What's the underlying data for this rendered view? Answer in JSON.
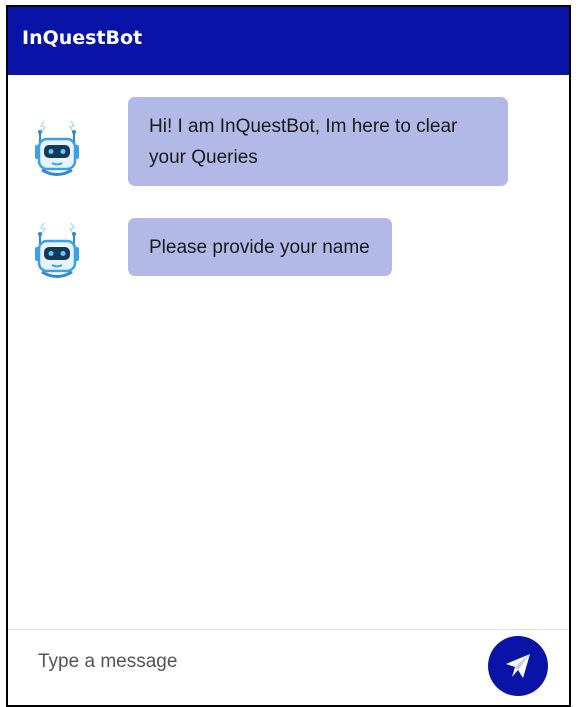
{
  "header": {
    "title": "InQuestBot"
  },
  "messages": [
    {
      "sender": "bot",
      "avatar_icon": "robot-icon",
      "text": "Hi! I am InQuestBot, Im here to clear your Queries"
    },
    {
      "sender": "bot",
      "avatar_icon": "robot-icon",
      "text": "Please provide your name"
    }
  ],
  "composer": {
    "placeholder": "Type a message",
    "value": "",
    "send_icon": "send-icon"
  },
  "colors": {
    "header_bg": "#0a13a8",
    "bubble_bg": "#b3b9e6",
    "send_button_bg": "#0a13a8",
    "robot_accent": "#3aa0e8"
  }
}
